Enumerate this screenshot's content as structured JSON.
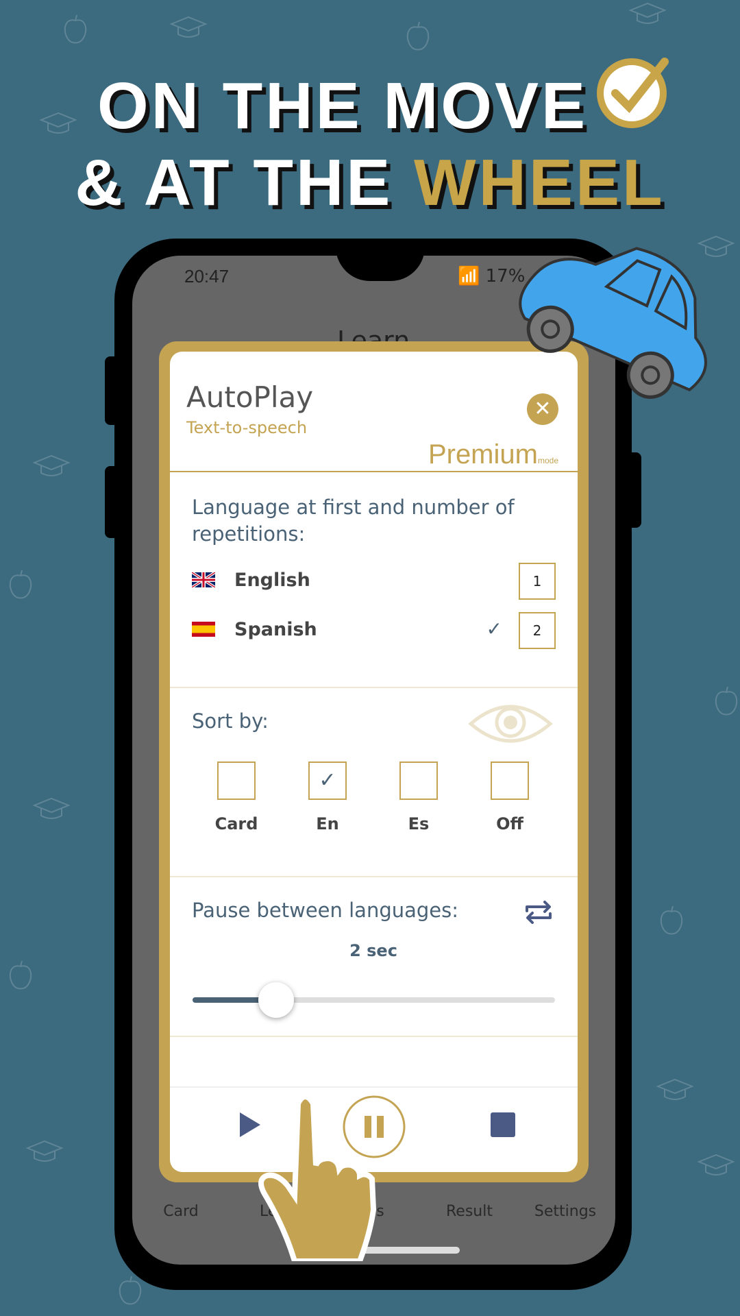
{
  "headline": {
    "line1": "ON THE MOVE",
    "line2_prefix": "& AT THE ",
    "line2_highlight": "WHEEL"
  },
  "colors": {
    "background": "#3c6a7f",
    "gold": "#c4a453",
    "accent_blue": "#4a6275",
    "control_blue": "#4a5a85"
  },
  "status_bar": {
    "time": "20:47",
    "battery": "17%"
  },
  "app": {
    "title": "Learn"
  },
  "dialog": {
    "title": "AutoPlay",
    "subtitle": "Text-to-speech",
    "premium": "Premium",
    "premium_suffix": "mode",
    "close_icon": "close-icon",
    "language_label": "Language at first and number of repetitions:",
    "languages": [
      {
        "name": "English",
        "flag": "uk-flag",
        "repetitions": "1",
        "checked": false
      },
      {
        "name": "Spanish",
        "flag": "spain-flag",
        "repetitions": "2",
        "checked": true
      }
    ],
    "sort_label": "Sort by:",
    "sort_options": [
      {
        "label": "Card",
        "checked": false
      },
      {
        "label": "En",
        "checked": true
      },
      {
        "label": "Es",
        "checked": false
      },
      {
        "label": "Off",
        "checked": false
      }
    ],
    "pause_label": "Pause between languages:",
    "pause_value": "2 sec",
    "pause_slider_fraction": 0.23,
    "controls": [
      "play-icon",
      "pause-icon",
      "stop-icon"
    ]
  },
  "bottom_nav": [
    {
      "label": "Card"
    },
    {
      "label": "Lear"
    },
    {
      "label": "s"
    },
    {
      "label": "Result"
    },
    {
      "label": "Settings"
    }
  ]
}
